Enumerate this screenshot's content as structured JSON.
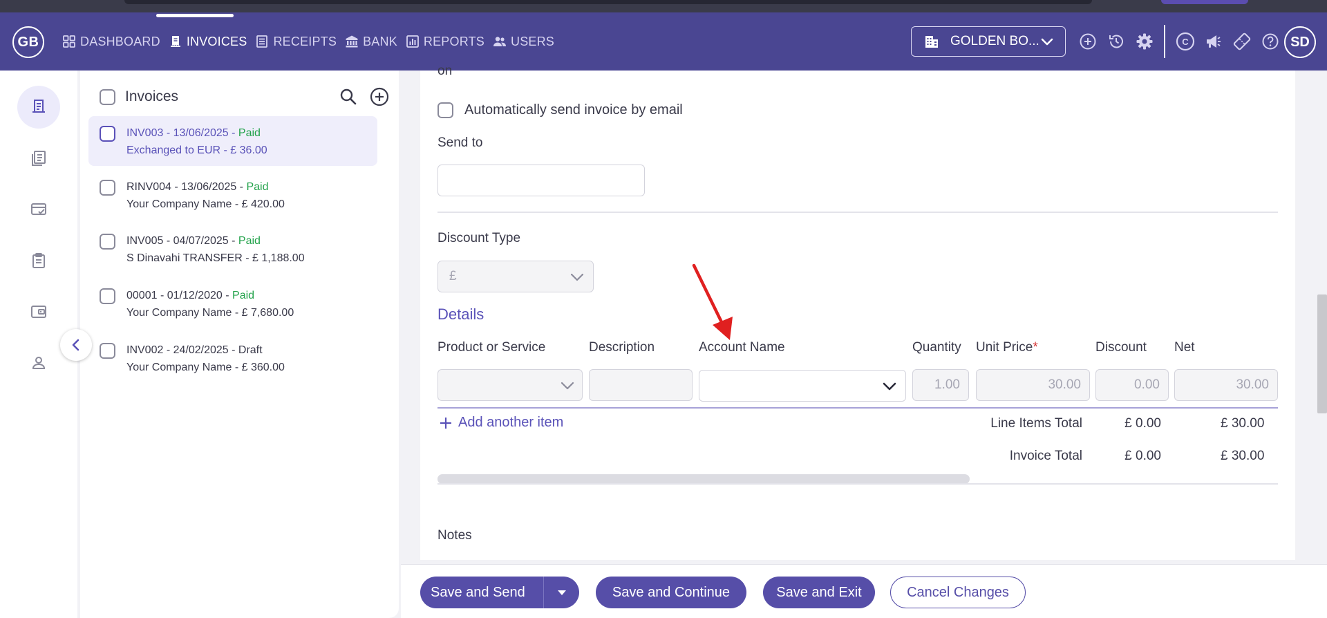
{
  "nav": {
    "logo": "GB",
    "items": [
      {
        "label": "DASHBOARD",
        "icon": "dashboard-grid-icon"
      },
      {
        "label": "INVOICES",
        "icon": "invoice-icon"
      },
      {
        "label": "RECEIPTS",
        "icon": "receipt-icon"
      },
      {
        "label": "BANK",
        "icon": "bank-icon"
      },
      {
        "label": "REPORTS",
        "icon": "reports-chart-icon"
      },
      {
        "label": "USERS",
        "icon": "users-icon"
      }
    ],
    "active": "INVOICES",
    "company": "GOLDEN BO...",
    "avatar": "SD"
  },
  "list": {
    "title": "Invoices",
    "items": [
      {
        "ref": "INV003 - 13/06/2025 - ",
        "status": "Paid",
        "sub": "Exchanged to EUR - £ 36.00"
      },
      {
        "ref": "RINV004 - 13/06/2025 - ",
        "status": "Paid",
        "sub": "Your Company Name - £ 420.00"
      },
      {
        "ref": "INV005 - 04/07/2025 - ",
        "status": "Paid",
        "sub": "S Dinavahi TRANSFER - £ 1,188.00"
      },
      {
        "ref": "00001 - 01/12/2020 - ",
        "status": "Paid",
        "sub": "Your Company Name - £ 7,680.00"
      },
      {
        "ref": "INV002 - 24/02/2025 - Draft",
        "status": "",
        "sub": "Your Company Name - £ 360.00"
      }
    ]
  },
  "form": {
    "cut_label": "on",
    "auto_email": "Automatically send invoice by email",
    "send_to_label": "Send to",
    "send_to_value": "",
    "discount_type_label": "Discount Type",
    "discount_type_value": "£",
    "details_title": "Details",
    "columns": {
      "product": "Product or Service",
      "description": "Description",
      "account": "Account Name",
      "quantity": "Quantity",
      "unit_price": "Unit Price",
      "required_mark": "*",
      "discount": "Discount",
      "net": "Net"
    },
    "row": {
      "quantity": "1.00",
      "unit_price": "30.00",
      "discount": "0.00",
      "net": "30.00"
    },
    "add_item": "Add another item",
    "line_items_total_label": "Line Items Total",
    "line_items_discount": "£ 0.00",
    "line_items_net": "£ 30.00",
    "invoice_total_label": "Invoice Total",
    "invoice_total_discount": "£ 0.00",
    "invoice_total_net": "£ 30.00",
    "notes_label": "Notes"
  },
  "actions": {
    "save_send": "Save and Send",
    "save_continue": "Save and Continue",
    "save_exit": "Save and Exit",
    "cancel": "Cancel Changes"
  },
  "colors": {
    "nav_bg": "#4a4692",
    "accent": "#564ea8",
    "paid": "#22a24a",
    "annotation_arrow": "#e02020"
  }
}
